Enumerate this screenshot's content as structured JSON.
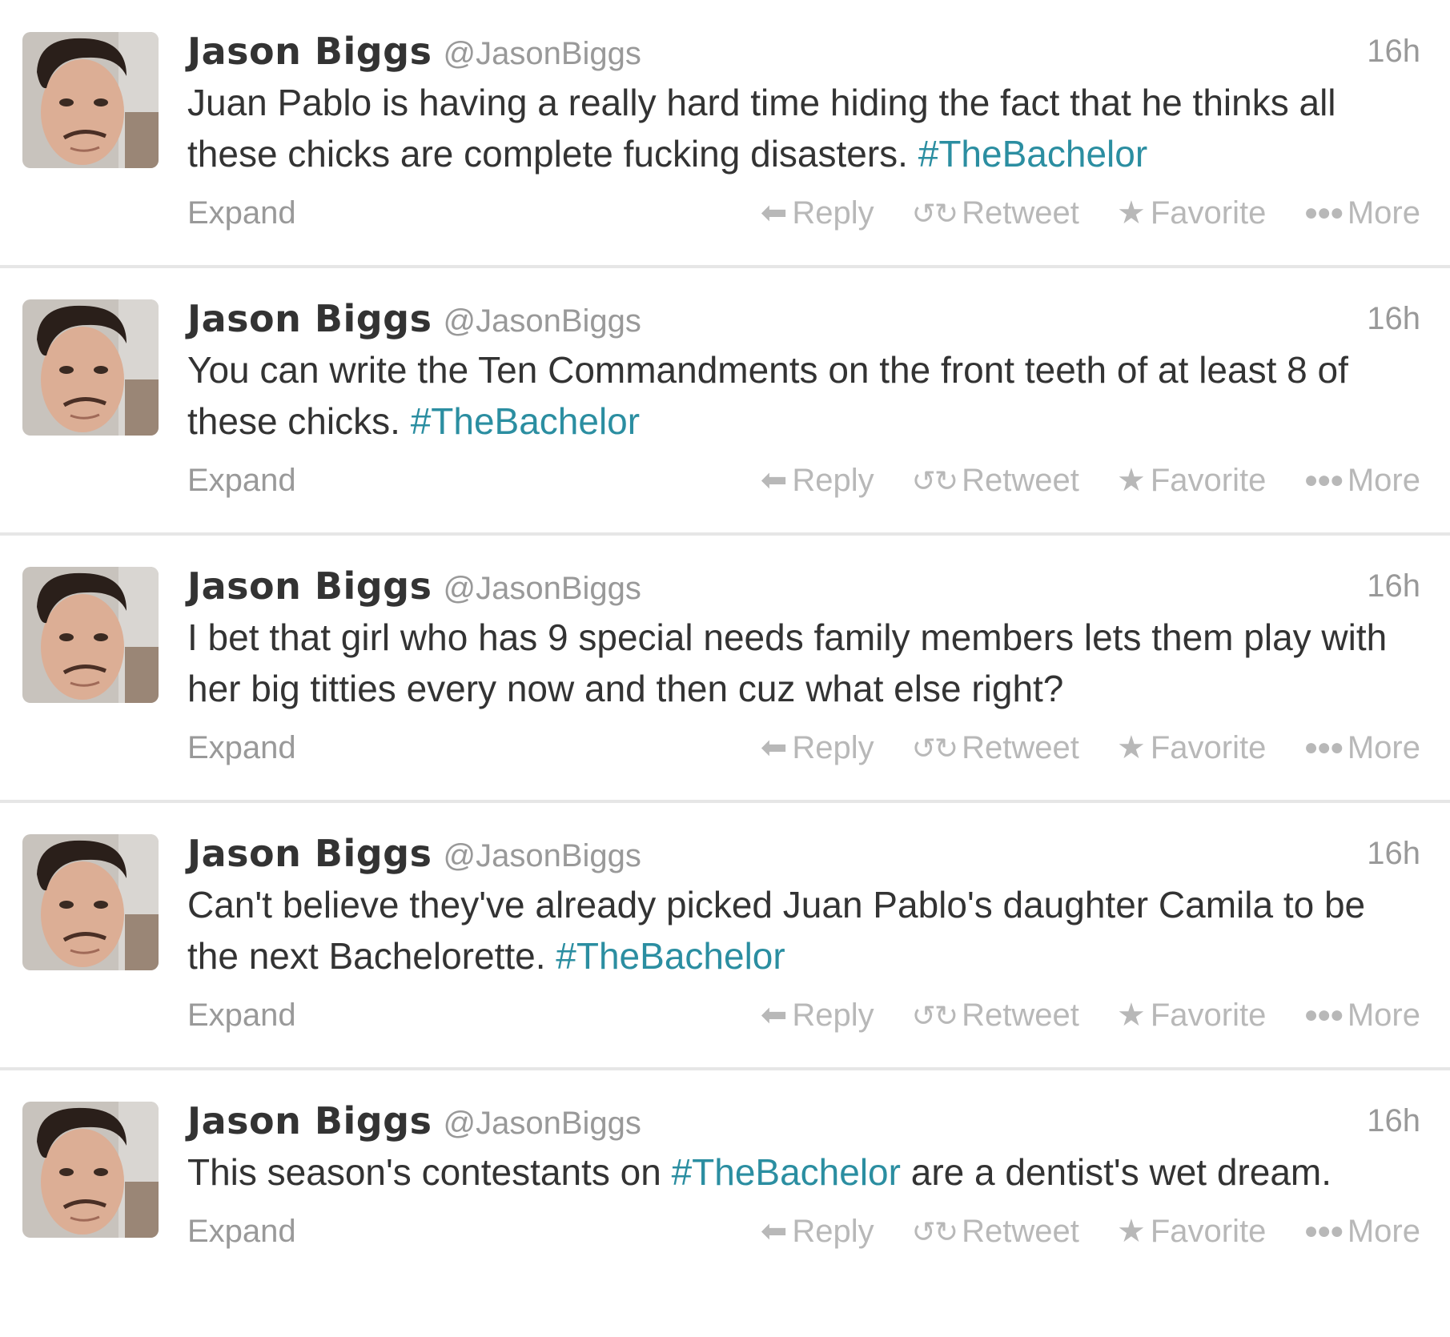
{
  "tweets": [
    {
      "name": "Jason Biggs",
      "handle": "@JasonBiggs",
      "time": "16h",
      "text_before": "Juan Pablo is having a really hard time hiding the fact that he thinks all these chicks are complete fucking disasters. ",
      "hashtag": "#TheBachelor",
      "text_after": "",
      "expand": "Expand",
      "reply": "Reply",
      "retweet": "Retweet",
      "favorite": "Favorite",
      "more": "More"
    },
    {
      "name": "Jason Biggs",
      "handle": "@JasonBiggs",
      "time": "16h",
      "text_before": "You can write the Ten Commandments on the front teeth of at least 8 of these chicks. ",
      "hashtag": "#TheBachelor",
      "text_after": "",
      "expand": "Expand",
      "reply": "Reply",
      "retweet": "Retweet",
      "favorite": "Favorite",
      "more": "More"
    },
    {
      "name": "Jason Biggs",
      "handle": "@JasonBiggs",
      "time": "16h",
      "text_before": "I bet that girl who has 9 special needs family members lets them play with her big titties every now and then cuz what else right?",
      "hashtag": "",
      "text_after": "",
      "expand": "Expand",
      "reply": "Reply",
      "retweet": "Retweet",
      "favorite": "Favorite",
      "more": "More"
    },
    {
      "name": "Jason Biggs",
      "handle": "@JasonBiggs",
      "time": "16h",
      "text_before": "Can't believe they've already picked Juan Pablo's daughter Camila to be the next Bachelorette. ",
      "hashtag": "#TheBachelor",
      "text_after": "",
      "expand": "Expand",
      "reply": "Reply",
      "retweet": "Retweet",
      "favorite": "Favorite",
      "more": "More"
    },
    {
      "name": "Jason Biggs",
      "handle": "@JasonBiggs",
      "time": "16h",
      "text_before": "This season's contestants on ",
      "hashtag": "#TheBachelor",
      "text_after": " are a dentist's wet dream.",
      "expand": "Expand",
      "reply": "Reply",
      "retweet": "Retweet",
      "favorite": "Favorite",
      "more": "More"
    }
  ],
  "icons": {
    "reply": "reply-arrow-icon",
    "retweet": "retweet-icon",
    "favorite": "star-icon",
    "more": "ellipsis-icon"
  },
  "colors": {
    "hashtag": "#2b8ea1",
    "name": "#333333",
    "meta": "#999999",
    "action": "#b8b8b8",
    "divider": "#e6e6e6"
  }
}
